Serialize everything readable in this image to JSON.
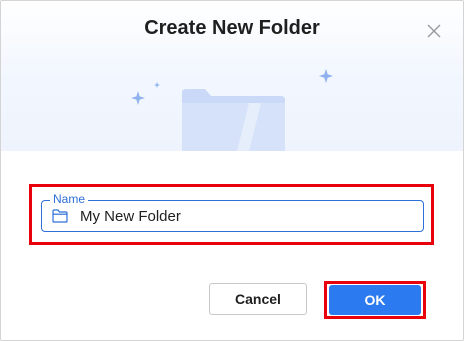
{
  "dialog": {
    "title": "Create New Folder",
    "close_icon": "close-icon",
    "illustration_icon": "folder-illustration-icon"
  },
  "name_field": {
    "label": "Name",
    "value": "My New Folder",
    "icon": "folder-icon"
  },
  "actions": {
    "cancel_label": "Cancel",
    "ok_label": "OK"
  },
  "colors": {
    "accent": "#2b7af0",
    "field_border": "#2e6fd8",
    "highlight": "#e8000b",
    "illustration": "#c9d9f7",
    "sparkle": "#8fb1ee"
  }
}
